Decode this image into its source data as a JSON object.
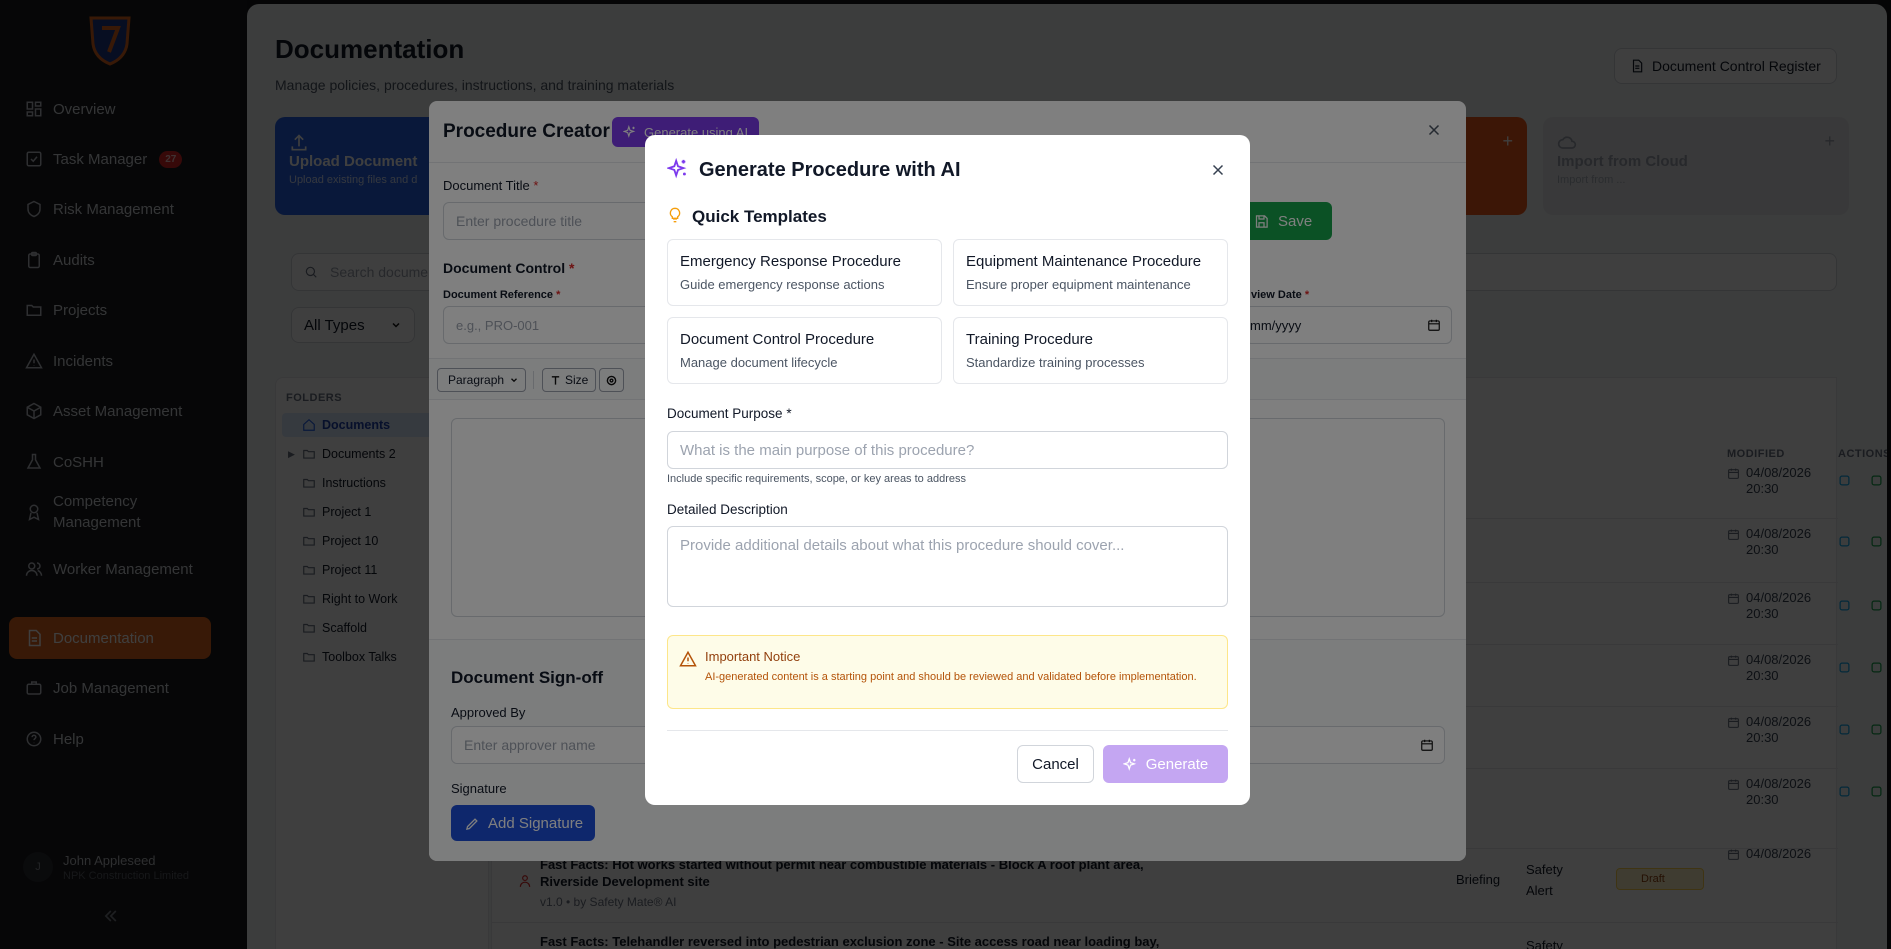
{
  "colors": {
    "sidebar_bg": "#18191c",
    "active_nav": "#e0661c",
    "ai_purple": "#7c3aed",
    "save_green": "#16a34a",
    "signature_blue": "#1d4ed8",
    "generate_disabled": "#c4a6f2"
  },
  "sidebar": {
    "items": [
      {
        "label": "Overview",
        "icon": "grid-icon"
      },
      {
        "label": "Task Manager",
        "icon": "checkbox-icon",
        "badge": "27"
      },
      {
        "label": "Risk Management",
        "icon": "shield-icon"
      },
      {
        "label": "Audits",
        "icon": "clipboard-icon"
      },
      {
        "label": "Projects",
        "icon": "folder-icon"
      },
      {
        "label": "Incidents",
        "icon": "warning-icon"
      },
      {
        "label": "Asset Management",
        "icon": "package-icon"
      },
      {
        "label": "CoSHH",
        "icon": "flask-icon"
      },
      {
        "label": "Competency Management",
        "icon": "award-icon"
      },
      {
        "label": "Worker Management",
        "icon": "users-icon"
      },
      {
        "label": "Documentation",
        "icon": "document-icon"
      },
      {
        "label": "Job Management",
        "icon": "briefcase-icon"
      },
      {
        "label": "Help",
        "icon": "help-icon"
      }
    ],
    "user": {
      "initial": "J",
      "name": "John Appleseed",
      "org": "NPK Construction Limited"
    }
  },
  "page": {
    "title": "Documentation",
    "subtitle": "Manage policies, procedures, instructions, and training materials",
    "register_button": "Document Control Register",
    "cards": {
      "upload_title": "Upload Document",
      "upload_desc": "Upload existing files and d",
      "cloud_title": "Import from Cloud",
      "cloud_desc": "Import from ..."
    },
    "search_placeholder": "Search docume",
    "type_filter": "All Types",
    "folders_header": "FOLDERS",
    "folders": [
      "Documents",
      "Documents 2",
      "Instructions",
      "Project 1",
      "Project 10",
      "Project 11",
      "Right to Work",
      "Scaffold",
      "Toolbox Talks"
    ],
    "columns": {
      "modified": "MODIFIED",
      "actions": "ACTIONS"
    },
    "rows": [
      {
        "date": "04/08/2026",
        "time": "20:30"
      },
      {
        "date": "04/08/2026",
        "time": "20:30"
      },
      {
        "date": "04/08/2026",
        "time": "20:30"
      },
      {
        "date": "04/08/2026",
        "time": "20:30"
      },
      {
        "date": "04/08/2026",
        "time": "20:30"
      },
      {
        "date": "04/08/2026",
        "time": "20:30"
      },
      {
        "date": "04/08/2026",
        "time": ""
      }
    ],
    "visible_docs": [
      {
        "title": "Fast Facts: Hot works started without permit near combustible materials - Block A roof plant area, Riverside Development site",
        "meta": "v1.0 • by Safety Mate® AI",
        "type": "Briefing",
        "category": "Safety Alert",
        "status": "Draft"
      },
      {
        "title": "Fast Facts: Telehandler reversed into pedestrian exclusion zone - Site access road near loading bay,",
        "type": "Safety"
      }
    ]
  },
  "procedure_creator": {
    "title": "Procedure Creator",
    "ai_button": "Generate using AI",
    "doc_title_label": "Document Title",
    "doc_title_placeholder": "Enter procedure title",
    "save_label": "Save",
    "doc_control_label": "Document Control",
    "doc_ref_label": "Document Reference",
    "doc_ref_placeholder": "e.g., PRO-001",
    "review_date_label": "view Date",
    "review_date_value": "mm/yyyy",
    "toolbar": {
      "paragraph": "Paragraph",
      "size": "Size"
    },
    "signoff_title": "Document Sign-off",
    "approved_by_label": "Approved By",
    "approver_placeholder": "Enter approver name",
    "signature_label": "Signature",
    "add_signature": "Add Signature"
  },
  "ai_dialog": {
    "title": "Generate Procedure with AI",
    "quick_templates": "Quick Templates",
    "templates": [
      {
        "name": "Emergency Response Procedure",
        "desc": "Guide emergency response actions"
      },
      {
        "name": "Equipment Maintenance Procedure",
        "desc": "Ensure proper equipment maintenance"
      },
      {
        "name": "Document Control Procedure",
        "desc": "Manage document lifecycle"
      },
      {
        "name": "Training Procedure",
        "desc": "Standardize training processes"
      }
    ],
    "purpose_label": "Document Purpose",
    "purpose_placeholder": "What is the main purpose of this procedure?",
    "purpose_help": "Include specific requirements, scope, or key areas to address",
    "description_label": "Detailed Description",
    "description_placeholder": "Provide additional details about what this procedure should cover...",
    "notice_title": "Important Notice",
    "notice_text": "AI-generated content is a starting point and should be reviewed and validated before implementation.",
    "cancel": "Cancel",
    "generate": "Generate"
  }
}
